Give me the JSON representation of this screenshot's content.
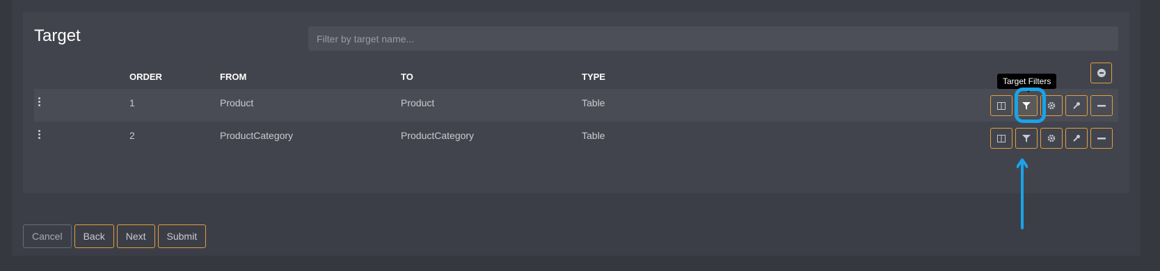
{
  "title": "Target",
  "filter": {
    "placeholder": "Filter by target name..."
  },
  "columns": {
    "order": "ORDER",
    "from": "FROM",
    "to": "TO",
    "type": "TYPE"
  },
  "rows": [
    {
      "order": "1",
      "from": "Product",
      "to": "Product",
      "type": "Table"
    },
    {
      "order": "2",
      "from": "ProductCategory",
      "to": "ProductCategory",
      "type": "Table"
    }
  ],
  "tooltip": "Target Filters",
  "row_actions": [
    "columns-icon",
    "filter-icon",
    "gear-icon",
    "wrench-icon",
    "minus-icon"
  ],
  "footer": {
    "cancel": "Cancel",
    "back": "Back",
    "next": "Next",
    "submit": "Submit"
  },
  "colors": {
    "accent": "#e0a040",
    "highlight": "#1aa3e8",
    "background": "#363840",
    "panel": "#42444d"
  }
}
